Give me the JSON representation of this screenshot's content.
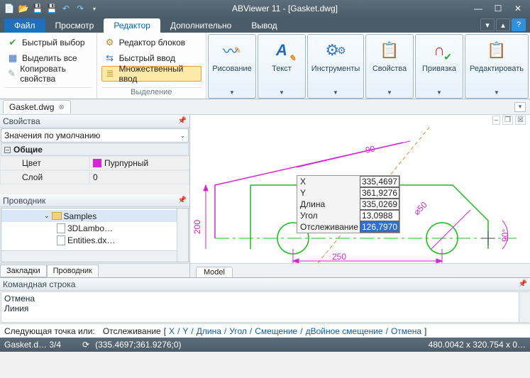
{
  "app": {
    "title": "ABViewer 11 - [Gasket.dwg]"
  },
  "qat_icons": [
    "new",
    "open",
    "save",
    "saveall",
    "undo",
    "redo",
    "dropdown"
  ],
  "win_icons": [
    "min",
    "max",
    "close"
  ],
  "menu": {
    "file": "Файл",
    "items": [
      "Просмотр",
      "Редактор",
      "Дополнительно",
      "Вывод"
    ],
    "active_index": 1,
    "right_icons": [
      "tip",
      "collapse",
      "help"
    ]
  },
  "ribbon": {
    "group1": {
      "items": [
        {
          "icon": "✔",
          "label": "Быстрый выбор",
          "colorClass": "c-green"
        },
        {
          "icon": "▦",
          "label": "Выделить все",
          "colorClass": "c-blue"
        },
        {
          "icon": "✎",
          "label": "Копировать свойства",
          "colorClass": "c-gray"
        }
      ]
    },
    "group2": {
      "items": [
        {
          "icon": "⚙",
          "label": "Редактор блоков"
        },
        {
          "icon": "⇆",
          "label": "Быстрый ввод"
        },
        {
          "icon": "≣",
          "label": "Множественный ввод",
          "selected": true
        }
      ],
      "caption": "Выделение"
    },
    "big": [
      {
        "icon": "〰",
        "label": "Рисование",
        "color": "#1f7bd6"
      },
      {
        "icon": "A",
        "label": "Текст",
        "color": "#1f7bd6",
        "overlay": "✎"
      },
      {
        "icon": "⚙",
        "label": "Инструменты",
        "color": "#1f7bd6"
      },
      {
        "icon": "📋",
        "label": "Свойства",
        "color": "#1f7bd6"
      },
      {
        "icon": "🧲",
        "label": "Привязка",
        "color": "#1f7bd6",
        "check": true
      },
      {
        "icon": "📋",
        "label": "Редактировать",
        "color": "#1f7bd6",
        "wide": true
      }
    ]
  },
  "file_tab": {
    "name": "Gasket.dwg"
  },
  "props": {
    "title": "Свойства",
    "dropdown": "Значения по умолчанию",
    "cat": "Общие",
    "rows": [
      {
        "k": "Цвет",
        "v": "Пурпурный",
        "swatch": true
      },
      {
        "k": "Слой",
        "v": "0"
      }
    ]
  },
  "explorer": {
    "title": "Проводник",
    "folder": "Samples",
    "files": [
      "3DLambo…",
      "Entities.dx…"
    ]
  },
  "left_tabs": {
    "items": [
      "Закладки",
      "Проводник"
    ],
    "active": 1
  },
  "canvas": {
    "mdi": [
      "–",
      "❐",
      "☒"
    ],
    "coords": [
      {
        "k": "X",
        "v": "335,4697"
      },
      {
        "k": "Y",
        "v": "361,9276"
      },
      {
        "k": "Длина",
        "v": "335,0269"
      },
      {
        "k": "Угол",
        "v": "13,0988"
      },
      {
        "k": "Отслеживание",
        "v": "126,7970",
        "sel": true
      }
    ],
    "dims": {
      "d90": "90",
      "d200": "200",
      "d250": "250",
      "d50": "⌀50",
      "a90": "90°"
    },
    "model_tab": "Model"
  },
  "cmd": {
    "title": "Командная строка",
    "history": [
      "Отмена",
      "Линия"
    ],
    "prompt_label": "Следующая точка или:",
    "track": "Отслеживание",
    "links": [
      "X",
      "Y",
      "Длина",
      "Угол",
      "Смещение",
      "дВойное смещение",
      "Отмена"
    ]
  },
  "status": {
    "left": "Gasket.d…   3/4",
    "mid": "(335.4697;361.9276;0)",
    "right": "480.0042 x 320.754 x 0…"
  }
}
